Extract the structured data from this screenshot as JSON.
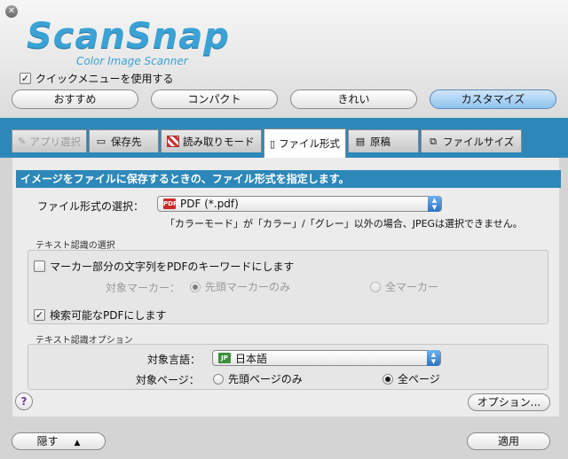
{
  "app": {
    "logo_text": "ScanSnap",
    "logo_subtitle": "Color Image Scanner"
  },
  "quick_menu": {
    "label": "クイックメニューを使用する",
    "checked": true
  },
  "presets": [
    {
      "label": "おすすめ",
      "active": false
    },
    {
      "label": "コンパクト",
      "active": false
    },
    {
      "label": "きれい",
      "active": false
    },
    {
      "label": "カスタマイズ",
      "active": true
    }
  ],
  "tabs": [
    {
      "label": "アプリ選択",
      "icon": "app-icon",
      "disabled": true
    },
    {
      "label": "保存先",
      "icon": "folder-icon"
    },
    {
      "label": "読み取りモード",
      "icon": "scan-mode-icon"
    },
    {
      "label": "ファイル形式",
      "icon": "file-icon",
      "active": true
    },
    {
      "label": "原稿",
      "icon": "document-icon"
    },
    {
      "label": "ファイルサイズ",
      "icon": "file-size-icon"
    }
  ],
  "panel": {
    "heading": "イメージをファイルに保存するときの、ファイル形式を指定します。",
    "file_format_label": "ファイル形式の選択：",
    "file_format_value": "PDF (*.pdf)",
    "file_format_note": "「カラーモード」が「カラー」/「グレー」以外の場合、JPEGは選択できません。",
    "text_recognition_title": "テキスト認識の選択",
    "marker_keyword_label": "マーカー部分の文字列をPDFのキーワードにします",
    "marker_keyword_checked": false,
    "target_marker_label": "対象マーカー：",
    "marker_first_only": "先頭マーカーのみ",
    "marker_all": "全マーカー",
    "searchable_pdf_label": "検索可能なPDFにします",
    "searchable_pdf_checked": true,
    "ocr_options_title": "テキスト認識オプション",
    "language_label": "対象言語：",
    "language_value": "日本語",
    "target_pages_label": "対象ページ：",
    "pages_first_only": "先頭ページのみ",
    "pages_all": "全ページ",
    "options_button": "オプション...",
    "help_label": "?"
  },
  "footer": {
    "hide_button": "隠す",
    "apply_button": "適用"
  }
}
